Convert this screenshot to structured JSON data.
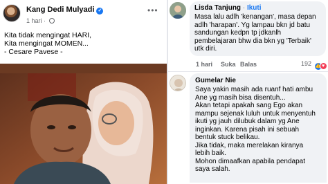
{
  "post": {
    "author": "Kang Dedi Mulyadi",
    "time": "1 hari",
    "lines": [
      "Kita tidak mengingat HARI,",
      "Kita mengingat MOMEN...",
      "- Cesare Pavese -"
    ],
    "icons": {
      "verified": "verified-badge-icon",
      "privacy": "globe-icon",
      "more": "more-options-icon"
    }
  },
  "comment1": {
    "author": "Lisda Tanjung",
    "follow_sep": " · ",
    "follow_label": "Ikuti",
    "lines": [
      "Masa lalu adlh 'kenangan', masa depan",
      "adlh 'harapan'. Yg lampau bkn jd batu",
      "sandungan kedpn tp jdkanlh",
      "pembelajaran bhw dia bkn yg 'Terbaik'",
      "utk diri."
    ],
    "time": "1 hari",
    "like_label": "Suka",
    "reply_label": "Balas",
    "reaction_count": "192",
    "colors": {
      "like": "#1877f2",
      "love": "#f33e58"
    }
  },
  "comment2": {
    "author": "Gumelar Nie",
    "lines": [
      "Saya yakin masih ada ruanf hati ambu",
      "Ane yg masih bisa disentuh...",
      "Akan tetapi apakah sang Ego akan",
      "mampu sejenak luluh untuk menyentuh",
      "ikuti yg jauh dilubuk dalam yg Ane",
      "inginkan. Karena pisah ini sebuah",
      "bentuk stuck belikau.",
      "Jika tidak, maka merelakan kiranya",
      "lebih baik.",
      "Mohon dimaafkan apabila pendapat",
      "saya salah."
    ]
  }
}
